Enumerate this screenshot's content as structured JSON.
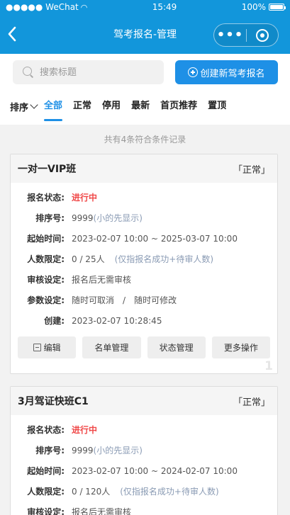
{
  "status_bar": {
    "carrier": "●●●●● WeChat",
    "time": "15:49",
    "battery": "100%"
  },
  "nav": {
    "title": "驾考报名-管理",
    "back_icon": "back-arrow-icon",
    "more_icon": "more-dots-icon",
    "close_icon": "target-close-icon"
  },
  "search": {
    "placeholder": "搜索标题",
    "value": ""
  },
  "create_button": {
    "label": "创建新驾考报名"
  },
  "filters": {
    "sort_label": "排序",
    "tabs": [
      {
        "label": "全部",
        "active": true
      },
      {
        "label": "正常",
        "active": false
      },
      {
        "label": "停用",
        "active": false
      },
      {
        "label": "最新",
        "active": false
      },
      {
        "label": "首页推荐",
        "active": false
      },
      {
        "label": "置顶",
        "active": false
      }
    ]
  },
  "summary": "共有4条符合条件记录",
  "cards": [
    {
      "title": "一对一VIP班",
      "status": "「正常」",
      "rows": [
        {
          "key": "报名状态:",
          "value": "进行中"
        },
        {
          "key": "排序号:",
          "value": "9999",
          "note": "(小的先显示)"
        },
        {
          "key": "起始时间:",
          "value": "2023-02-07 10:00 ~ 2025-03-07 10:00"
        },
        {
          "key": "人数限定:",
          "value": "0 / 25人",
          "note": "(仅指报名成功+待审人数)"
        },
        {
          "key": "审核设定:",
          "value": "报名后无需审核"
        },
        {
          "key": "参数设定:",
          "value": "随时可取消",
          "sep": "/",
          "value2": "随时可修改"
        },
        {
          "key": "创建:",
          "value": "2023-02-07 10:28:45"
        }
      ],
      "buttons": [
        "编辑",
        "名单管理",
        "状态管理",
        "更多操作"
      ],
      "index": "1"
    },
    {
      "title": "3月驾证快班C1",
      "status": "「正常」",
      "rows": [
        {
          "key": "报名状态:",
          "value": "进行中"
        },
        {
          "key": "排序号:",
          "value": "9999",
          "note": "(小的先显示)"
        },
        {
          "key": "起始时间:",
          "value": "2023-02-07 10:00 ~ 2024-02-07 10:00"
        },
        {
          "key": "人数限定:",
          "value": "0 / 120人",
          "note": "(仅指报名成功+待审人数)"
        },
        {
          "key": "审核设定:",
          "value": "报名后无需审核"
        }
      ]
    }
  ]
}
